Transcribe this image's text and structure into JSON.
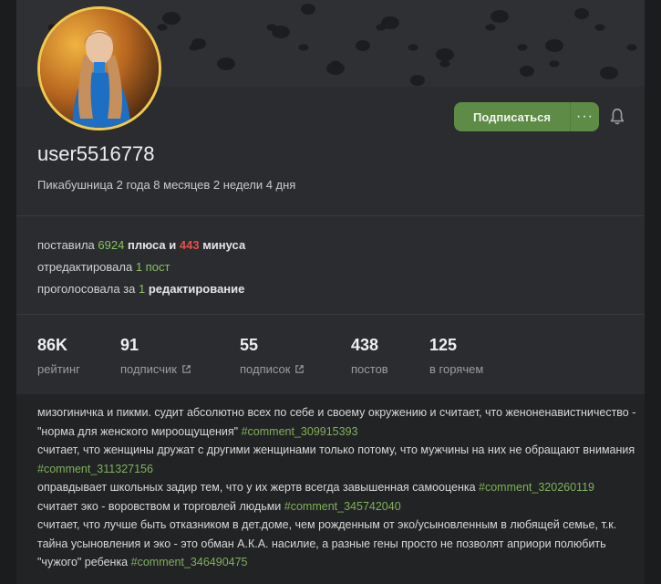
{
  "profile": {
    "username": "user5516778",
    "tenure": "Пикабушница 2 года 8 месяцев 2 недели 4 дня",
    "subscribe_label": "Подписаться",
    "more_label": "···"
  },
  "activity": {
    "line1": {
      "prefix": "поставила",
      "plus_count": "6924",
      "plus_word": "плюса и",
      "minus_count": "443",
      "minus_word": "минуса"
    },
    "line2": {
      "prefix": "отредактировала",
      "count": "1 пост"
    },
    "line3": {
      "prefix": "проголосовала за",
      "count": "1",
      "suffix": "редактирование"
    }
  },
  "metrics": [
    {
      "value": "86K",
      "label": "рейтинг"
    },
    {
      "value": "91",
      "label": "подписчик"
    },
    {
      "value": "55",
      "label": "подписок"
    },
    {
      "value": "438",
      "label": "постов"
    },
    {
      "value": "125",
      "label": "в горячем"
    }
  ],
  "note": {
    "p1": "мизогиничка и пикми. судит абсолютно всех по себе и своему окружению и считает, что женоненавистничество - \"норма для женского мироощущения\"",
    "l1": "#comment_309915393",
    "p2": "считает, что женщины дружат с другими женщинами только потому, что мужчины на них не обращают внимания",
    "l2": "#comment_311327156",
    "p3": "оправдывает школьных задир тем, что у их жертв всегда завышенная самооценка",
    "l3": "#comment_320260119",
    "p4": "считает эко - воровством и торговлей людьми",
    "l4": "#comment_345742040",
    "p5": "считает, что лучше быть отказником в дет.доме, чем рожденным от эко/усыновленным в любящей семье, т.к. тайна усыновления и эко - это обман А.К.А. насилие, а разные гены просто не позволят априори полюбить \"чужого\" ребенка",
    "l5": "#comment_346490475"
  },
  "colors": {
    "accent_green": "#5e8b45",
    "plus": "#8ac35f",
    "minus": "#e5504a",
    "avatar_ring": "#f2c94c"
  }
}
